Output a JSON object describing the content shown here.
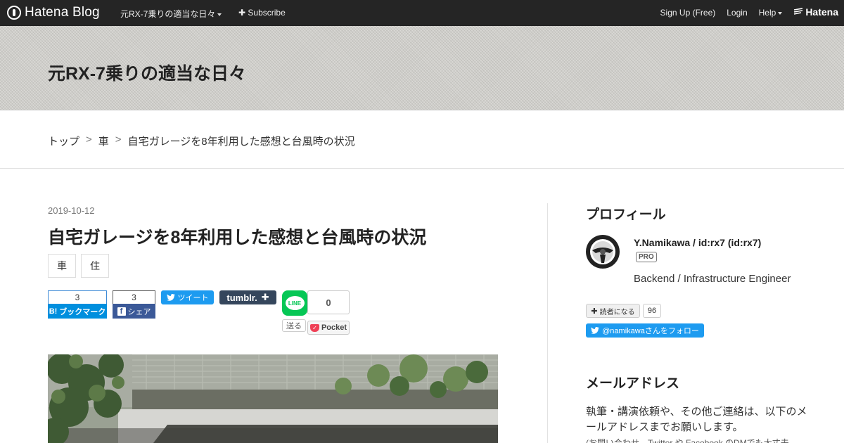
{
  "topbar": {
    "logo_text": "Hatena Blog",
    "blog_selector": "元RX-7乗りの適当な日々",
    "subscribe": "Subscribe",
    "signup": "Sign Up (Free)",
    "login": "Login",
    "help": "Help",
    "hatena_logo": "Hatena"
  },
  "header": {
    "blog_title": "元RX-7乗りの適当な日々"
  },
  "breadcrumb": {
    "items": [
      "トップ",
      "車",
      "自宅ガレージを8年利用した感想と台風時の状況"
    ],
    "separator": ">"
  },
  "entry": {
    "date": "2019-10-12",
    "title": "自宅ガレージを8年利用した感想と台風時の状況",
    "categories": [
      "車",
      "住"
    ]
  },
  "share": {
    "hatena_count": "3",
    "hatena_label": "ブックマーク",
    "hatena_mark": "B!",
    "facebook_count": "3",
    "facebook_label": "シェア",
    "twitter_label": "ツイート",
    "tumblr_label": "tumblr.",
    "line_label": "LINE",
    "line_send": "送る",
    "pocket_count": "0",
    "pocket_label": "Pocket"
  },
  "sidebar": {
    "profile_heading": "プロフィール",
    "profile_name": "Y.Namikawa / id:rx7 (id:rx7)",
    "pro_badge": "PRO",
    "profile_desc": "Backend / Infrastructure Engineer",
    "reader_button": "読者になる",
    "reader_count": "96",
    "follow_handle": "@namikawa",
    "follow_suffix": "さんをフォロー",
    "mail_heading": "メールアドレス",
    "mail_text": "執筆・講演依頼や、その他ご連絡は、以下のメールアドレスまでお願いします。",
    "mail_note": "(お問い合わせ、Twitter や Facebook のDMでも大丈夫"
  },
  "colors": {
    "topbar_bg": "#252525",
    "hatena_blue": "#008fde",
    "facebook_blue": "#3b5998",
    "twitter_blue": "#1d9bf0",
    "tumblr_navy": "#35465c",
    "line_green": "#06c755",
    "pocket_red": "#ef4056"
  }
}
